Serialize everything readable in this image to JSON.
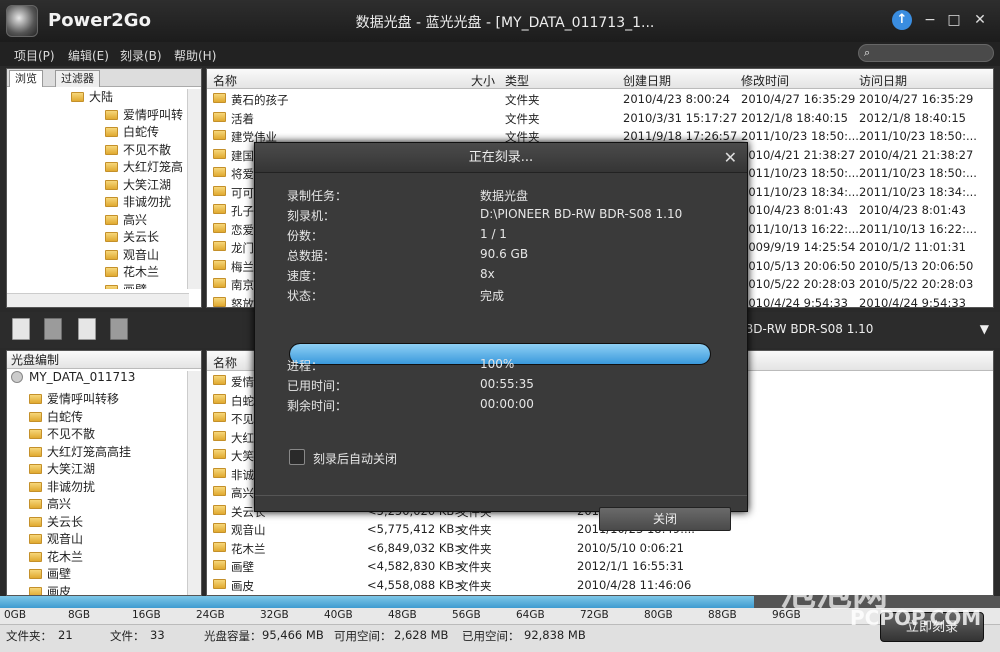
{
  "app": {
    "name": "Power2Go",
    "window_title": "数据光盘 - 蓝光光盘 - [MY_DATA_011713_1..."
  },
  "menu": [
    "项目(P)",
    "编辑(E)",
    "刻录(B)",
    "帮助(H)"
  ],
  "browse_tabs": [
    "浏览",
    "过滤器"
  ],
  "top_tree": [
    "大陆",
    "爱情呼叫转",
    "白蛇传",
    "不见不散",
    "大红灯笼高",
    "大笑江湖",
    "非诚勿扰",
    "高兴",
    "关云长",
    "观音山",
    "花木兰",
    "画壁"
  ],
  "file_columns": [
    "名称",
    "大小",
    "类型",
    "创建日期",
    "修改时间",
    "访问日期"
  ],
  "top_files": [
    {
      "name": "黄石的孩子",
      "type": "文件夹",
      "created": "2010/4/23 8:00:24",
      "modified": "2010/4/27 16:35:29",
      "accessed": "2010/4/27 16:35:29"
    },
    {
      "name": "活着",
      "type": "文件夹",
      "created": "2010/3/31 15:17:27",
      "modified": "2012/1/8 18:40:15",
      "accessed": "2012/1/8 18:40:15"
    },
    {
      "name": "建党伟业",
      "type": "文件夹",
      "created": "2011/9/18 17:26:57",
      "modified": "2011/10/23 18:50:...",
      "accessed": "2011/10/23 18:50:..."
    },
    {
      "name": "建国",
      "type": "",
      "created": "",
      "modified": "2010/4/21 21:38:27",
      "accessed": "2010/4/21 21:38:27"
    },
    {
      "name": "将爱",
      "type": "",
      "created": "",
      "modified": "2011/10/23 18:50:...",
      "accessed": "2011/10/23 18:50:..."
    },
    {
      "name": "可可",
      "type": "",
      "created": "",
      "modified": "2011/10/23 18:34:...",
      "accessed": "2011/10/23 18:34:..."
    },
    {
      "name": "孔子",
      "type": "",
      "created": "",
      "modified": "2010/4/23 8:01:43",
      "accessed": "2010/4/23 8:01:43"
    },
    {
      "name": "恋爱",
      "type": "",
      "created": "",
      "modified": "2011/10/13 16:22:...",
      "accessed": "2011/10/13 16:22:..."
    },
    {
      "name": "龙门",
      "type": "",
      "created": "",
      "modified": "2009/9/19 14:25:54",
      "accessed": "2010/1/2 11:01:31"
    },
    {
      "name": "梅兰",
      "type": "",
      "created": "",
      "modified": "2010/5/13 20:06:50",
      "accessed": "2010/5/13 20:06:50"
    },
    {
      "name": "南京",
      "type": "",
      "created": "",
      "modified": "2010/5/22 20:28:03",
      "accessed": "2010/5/22 20:28:03"
    },
    {
      "name": "怒放",
      "type": "",
      "created": "",
      "modified": "2010/4/24 9:54:33",
      "accessed": "2010/4/24 9:54:33"
    }
  ],
  "drive_selector": "BD-RW BDR-S08 1.10",
  "disc_panel": {
    "header": "光盘编制",
    "disc_name": "MY_DATA_011713"
  },
  "bottom_tree": [
    "爱情呼叫转移",
    "白蛇传",
    "不见不散",
    "大红灯笼高高挂",
    "大笑江湖",
    "非诚勿扰",
    "高兴",
    "关云长",
    "观音山",
    "花木兰",
    "画壁",
    "画皮"
  ],
  "bottom_files": [
    {
      "name": "爱情",
      "size": "",
      "type": "",
      "date": ""
    },
    {
      "name": "白蛇",
      "size": "",
      "type": "",
      "date": ""
    },
    {
      "name": "不见",
      "size": "",
      "type": "",
      "date": ""
    },
    {
      "name": "大红",
      "size": "",
      "type": "",
      "date": ""
    },
    {
      "name": "大笑",
      "size": "",
      "type": "",
      "date": ""
    },
    {
      "name": "非诚",
      "size": "",
      "type": "",
      "date": ""
    },
    {
      "name": "高兴",
      "size": "",
      "type": "",
      "date": ""
    },
    {
      "name": "关云长",
      "size": "<5,250,020 KB>",
      "type": "文件夹",
      "date": "2011/10/23 18:..."
    },
    {
      "name": "观音山",
      "size": "<5,775,412 KB>",
      "type": "文件夹",
      "date": "2011/10/23 18:49:..."
    },
    {
      "name": "花木兰",
      "size": "<6,849,032 KB>",
      "type": "文件夹",
      "date": "2010/5/10 0:06:21"
    },
    {
      "name": "画壁",
      "size": "<4,582,830 KB>",
      "type": "文件夹",
      "date": "2012/1/1 16:55:31"
    },
    {
      "name": "画皮",
      "size": "<4,558,088 KB>",
      "type": "文件夹",
      "date": "2010/4/28 11:46:06"
    }
  ],
  "capacity_ticks": [
    "0GB",
    "8GB",
    "16GB",
    "24GB",
    "32GB",
    "40GB",
    "48GB",
    "56GB",
    "64GB",
    "72GB",
    "80GB",
    "88GB",
    "96GB"
  ],
  "capacity_fill_fraction": 0.92,
  "status": {
    "folders_label": "文件夹：",
    "folders": "21",
    "files_label": "文件：",
    "files": "33",
    "capacity_label": "光盘容量：",
    "capacity": "95,466 MB",
    "free_label": "可用空间：",
    "free": "2,628 MB",
    "used_label": "已用空间：",
    "used": "92,838 MB"
  },
  "burn_button": "立即刻录",
  "watermark": {
    "main": "泡泡网",
    "sub": "PCPOP.COM"
  },
  "dialog": {
    "title": "正在刻录...",
    "labels": {
      "task": "录制任务：",
      "recorder": "刻录机：",
      "copies": "份数：",
      "total": "总数据：",
      "speed": "速度：",
      "state": "状态："
    },
    "values": {
      "task": "数据光盘",
      "recorder": "D:\\PIONEER BD-RW BDR-S08 1.10",
      "copies": "1 / 1",
      "total": "90.6 GB",
      "speed": "8x",
      "state": "完成"
    },
    "progress_fraction": 1.0,
    "progress_labels": {
      "progress": "进程：",
      "elapsed": "已用时间：",
      "remaining": "剩余时间："
    },
    "progress_values": {
      "progress": "100%",
      "elapsed": "00:55:35",
      "remaining": "00:00:00"
    },
    "auto_close": "刻录后自动关闭",
    "close_button": "关闭"
  },
  "colors": {
    "accent": "#3a99dc",
    "chrome": "#2a2a2a"
  }
}
